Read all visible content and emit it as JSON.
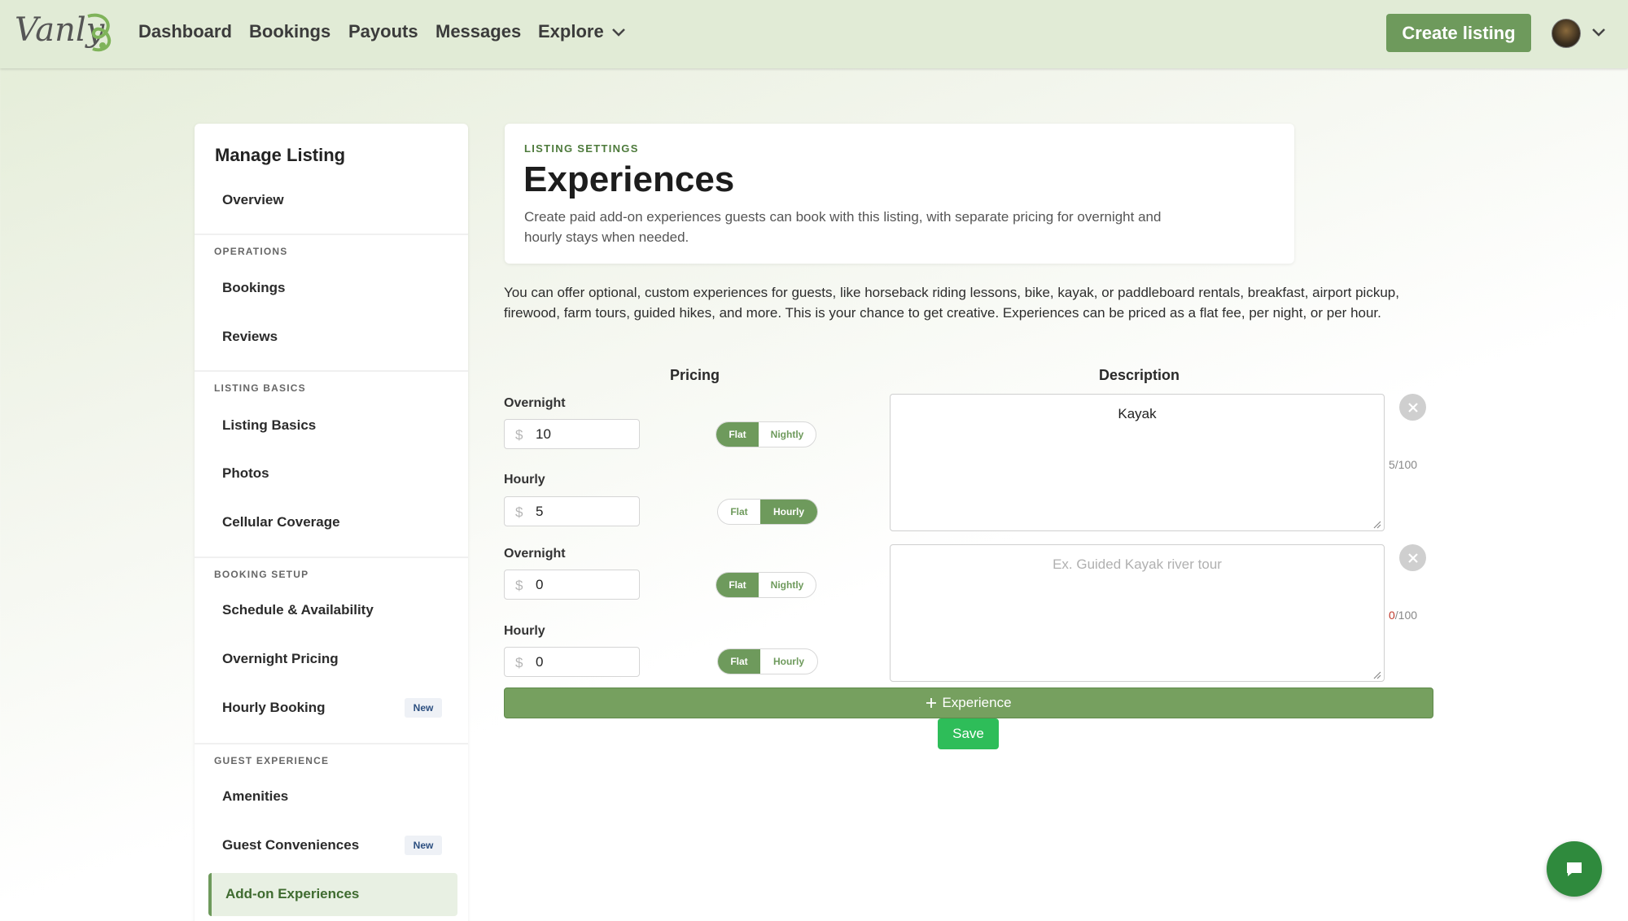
{
  "nav": {
    "logo_text": "Vanly",
    "links": [
      "Dashboard",
      "Bookings",
      "Payouts",
      "Messages",
      "Explore"
    ],
    "create_label": "Create listing"
  },
  "sidebar": {
    "title": "Manage Listing",
    "overview": "Overview",
    "sections": {
      "operations": "OPERATIONS",
      "listing_basics": "LISTING BASICS",
      "booking_setup": "BOOKING SETUP",
      "guest_experience": "GUEST EXPERIENCE"
    },
    "items": {
      "bookings": "Bookings",
      "reviews": "Reviews",
      "listing_basics": "Listing Basics",
      "photos": "Photos",
      "cellular": "Cellular Coverage",
      "schedule": "Schedule & Availability",
      "overnight_pricing": "Overnight Pricing",
      "hourly_booking": "Hourly Booking",
      "amenities": "Amenities",
      "guest_conveniences": "Guest Conveniences",
      "addon_experiences": "Add-on Experiences"
    },
    "new_badge": "New"
  },
  "header": {
    "eyebrow": "LISTING SETTINGS",
    "title": "Experiences",
    "subtitle": "Create paid add-on experiences guests can book with this listing, with separate pricing for overnight and hourly stays when needed."
  },
  "intro": "You can offer optional, custom experiences for guests, like horseback riding lessons, bike, kayak, or paddleboard rentals, breakfast, airport pickup, firewood, farm tours, guided hikes, and more. This is your chance to get creative. Experiences can be priced as a flat fee, per night, or per hour.",
  "columns": {
    "pricing": "Pricing",
    "description": "Description"
  },
  "labels": {
    "overnight": "Overnight",
    "hourly": "Hourly",
    "currency": "$",
    "flat": "Flat",
    "nightly": "Nightly",
    "hourly_opt": "Hourly"
  },
  "experiences": [
    {
      "overnight_price": "10",
      "overnight_mode": "Flat",
      "hourly_price": "5",
      "hourly_mode": "Hourly",
      "description": "Kayak",
      "char_used": "5",
      "char_max": "/100"
    },
    {
      "overnight_price": "0",
      "overnight_mode": "Flat",
      "hourly_price": "0",
      "hourly_mode": "Flat",
      "description": "",
      "placeholder": "Ex. Guided Kayak river tour",
      "char_used": "0",
      "char_max": "/100"
    }
  ],
  "add_experience_label": "Experience",
  "save_label": "Save",
  "colors": {
    "brand_green": "#6e9a5c",
    "save_green": "#2ebd59",
    "chat_green": "#2f8a3d",
    "nav_bg": "#e1ebd6"
  },
  "icons": {
    "explore_chevron": "chevron-down-icon",
    "avatar_chevron": "chevron-down-icon",
    "remove": "close-icon",
    "add": "plus-icon",
    "chat": "chat-icon"
  }
}
